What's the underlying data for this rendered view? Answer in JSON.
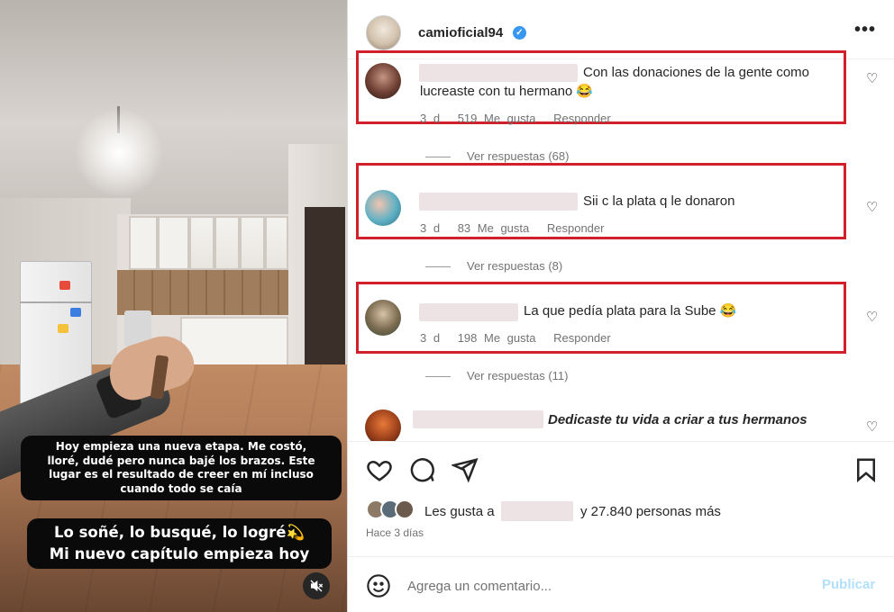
{
  "media": {
    "caption_lines": [
      "Hoy empieza una nueva etapa. Me costó,",
      "lloré, dudé pero nunca bajé los brazos. Este",
      "lugar es el resultado de creer en mí incluso",
      "cuando todo se caía"
    ],
    "big_caption_lines": [
      "Lo soñé, lo busqué, lo logré💫",
      "Mi nuevo capítulo empieza hoy"
    ],
    "mute_icon": "speaker-muted-icon"
  },
  "post": {
    "username": "camioficial94",
    "verified": true,
    "more_icon": "more-options-icon",
    "comments": [
      {
        "text_line1": "Con las donaciones de la gente como",
        "text_line2": "lucreaste con tu hermano 😂",
        "time": "3 d",
        "likes": "519 Me gusta",
        "reply": "Responder",
        "replies": "Ver respuestas (68)",
        "highlighted": true
      },
      {
        "text_line1": "Sii c la plata q le donaron",
        "time": "3 d",
        "likes": "83 Me gusta",
        "reply": "Responder",
        "replies": "Ver respuestas (8)",
        "highlighted": true
      },
      {
        "text_line1": "La que pedía plata para la Sube 😂",
        "time": "3 d",
        "likes": "198 Me gusta",
        "reply": "Responder",
        "replies": "Ver respuestas (11)",
        "highlighted": true
      },
      {
        "text_line1": "Dedicaste tu vida a criar a tus hermanos",
        "highlighted": false
      }
    ],
    "likes_prefix": "Les gusta a",
    "likes_suffix": "y 27.840 personas más",
    "time_ago": "Hace 3 días",
    "comment_placeholder": "Agrega un comentario...",
    "publish_label": "Publicar"
  },
  "colors": {
    "highlight": "#d11f2b",
    "verified": "#3897f0",
    "publish_disabled": "#b2dffc",
    "redaction": "#ede3e5"
  }
}
